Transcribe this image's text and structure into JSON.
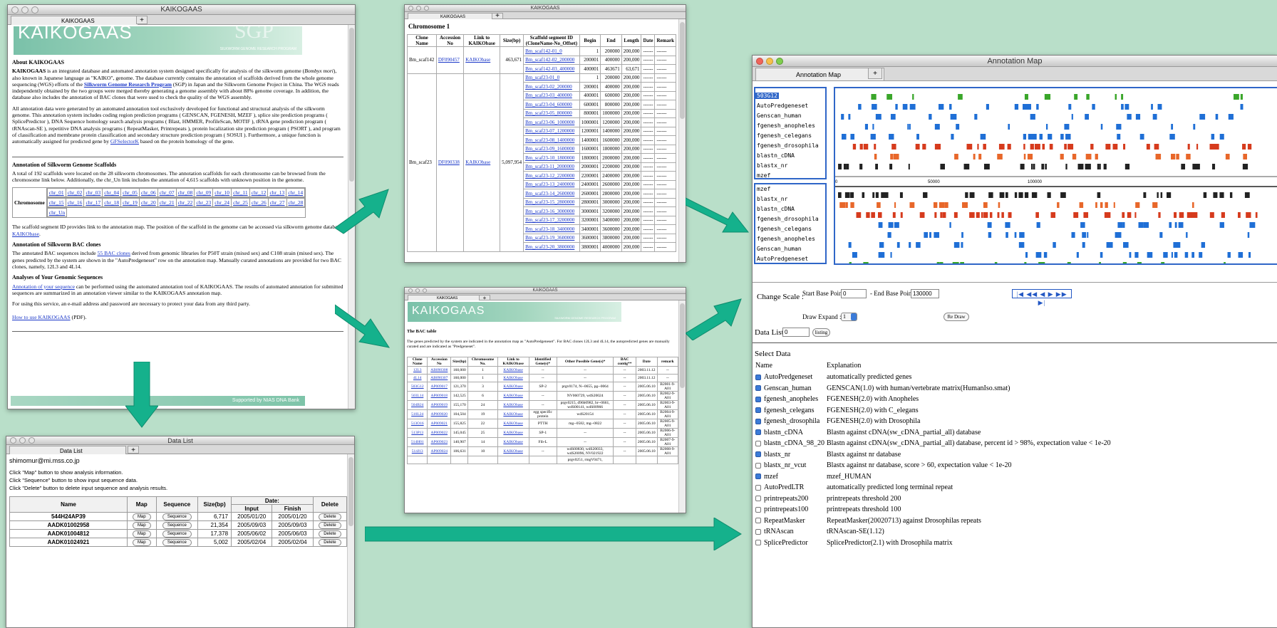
{
  "main_window": {
    "title": "KAIKOGAAS",
    "tab": "KAIKOGAAS",
    "banner": "KAIKOGAAS",
    "banner_sub": "SILKWORM GENOME RESEARCH PROGRAM",
    "banner_logo": "SGP",
    "about_heading": "About KAIKOGAAS",
    "about_p1_a": "KAIKOGAAS",
    "about_p1_b": " is an integrated database and automated annotation system designed specifically for analysis of the silkworm genome (",
    "about_p1_c": "Bombyx mori",
    "about_p1_d": "), also known in Japanese language as \"KAIKO\", genome. The database currently contains the annotation of scaffolds derived from the whole genome sequencing (WGS) efforts of the ",
    "about_p1_link": "Silkworm Genome Research Program",
    "about_p1_e": " (SGP) in Japan and the Silkworm Genome Project in China. The WGS reads independently obtained by the two groups were merged thereby generating a genome assembly with about 88% genome coverage. In addition, the database also includes the annotation of BAC clones that were used to check the quality of the WGS assembly.",
    "about_p2_a": "All annotation data were generated by an automated annotation tool exclusively developed for functional and structural analysis of the silkworm genome. This annotation system includes coding region prediction programs ( GENSCAN, FGENESH, MZEF ), splice site prediction programs ( SplicePredictor ), DNA Sequence homology search analysis programs ( Blast, HMMER, ProfileScan, MOTIF ), tRNA gene prediction program ( tRNAscan-SE ), repetitive DNA analysis programs ( RepeatMasker, Printrepeats ), protein localization site prediction program ( PSORT ), and program of classification and membrane protein classification and secondary structure prediction program ( SOSUI ). Furthermore, a unique function is automatically assigned for predicted gene by ",
    "about_p2_link": "GFSelectorK",
    "about_p2_b": " based on the protein homology of the gene.",
    "scaffold_heading": "Annotation of Silkworm Genome Scaffolds",
    "scaffold_p": "A total of 192 scaffolds were located on the 28 silkworm chromosomes. The annotation scaffolds for each chromosome can be browsed from the chromosome link below. Additionally, the chr_Un link includes the anntation of 4,615 scaffolds with unknown position in the genome.",
    "chromosome_label": "Chromosome",
    "chr_row1": [
      "chr_01",
      "chr_02",
      "chr_03",
      "chr_04",
      "chr_05",
      "chr_06",
      "chr_07",
      "chr_08",
      "chr_09",
      "chr_10",
      "chr_11",
      "chr_12",
      "chr_13",
      "chr_14"
    ],
    "chr_row2": [
      "chr_15",
      "chr_16",
      "chr_17",
      "chr_18",
      "chr_19",
      "chr_20",
      "chr_21",
      "chr_22",
      "chr_23",
      "chr_24",
      "chr_25",
      "chr_26",
      "chr_27",
      "chr_28"
    ],
    "chr_row3": [
      "chr_Un"
    ],
    "segment_p_a": "The scaffold segment ID provides link to the annotation map. The position of the scaffold in the genome can be accessed via silkworm genome database, ",
    "segment_p_link": "KAIKObase",
    "segment_p_b": ".",
    "bac_heading": "Annotation of Silkworm BAC clones",
    "bac_p_a": "The annotated BAC sequences include ",
    "bac_p_link": "55 BAC clones",
    "bac_p_b": " derived from genomic libraries for P50T strain (mixed sex) and C108 strain (mixed sex). The genes predicted by the system are shown in the \"AutoPredgeneset\" row on the annotation map. Manually curated annotations are provided for two BAC clones, namely, 12L3 and 4L14.",
    "analyses_heading": "Analyses of Your Genomic Sequences",
    "analyses_link": "Annotation of your sequence",
    "analyses_p": " can be performed using the automated annotation tool of KAIKOGAAS. The results of automated annotation for submitted sequences are summarized in an annotation viewer similar to the KAIKOGAAS annotation map.",
    "service_p": "For using this service, an e-mail address and password are necessary to protect your data from any third party.",
    "howto_link": "How to use KAIKOGAAS",
    "howto_suffix": " (PDF).",
    "footer": "Supported by NIAS DNA Bank"
  },
  "chromosome_window": {
    "title": "KAIKOGAAS",
    "tab": "KAIKOGAAS",
    "heading": "Chromosome 1",
    "headers": [
      "Clone Name",
      "Accession No",
      "Link to KAIKObase",
      "Size(bp)",
      "Scaffold segment ID (CloneName-No_Offset)",
      "Begin",
      "End",
      "Length",
      "Date",
      "Remark"
    ],
    "group1": {
      "clone": "Bm_scaf142",
      "accession": "DF090457",
      "link": "KAIKObase",
      "size": "463,671"
    },
    "group2": {
      "clone": "Bm_scaf23",
      "accession": "DF090338",
      "link": "KAIKObase",
      "size": "5,097,954"
    },
    "rows": [
      [
        "Bm_scaf142-01_0",
        "1",
        "200000",
        "200,000",
        "------",
        "------"
      ],
      [
        "Bm_scaf142-02_200000",
        "200001",
        "400000",
        "200,000",
        "------",
        "------"
      ],
      [
        "Bm_scaf142-03_400000",
        "400001",
        "463671",
        "63,671",
        "------",
        "------"
      ],
      [
        "Bm_scaf23-01_0",
        "1",
        "200000",
        "200,000",
        "------",
        "------"
      ],
      [
        "Bm_scaf23-02_200000",
        "200001",
        "400000",
        "200,000",
        "------",
        "------"
      ],
      [
        "Bm_scaf23-03_400000",
        "400001",
        "600000",
        "200,000",
        "------",
        "------"
      ],
      [
        "Bm_scaf23-04_600000",
        "600001",
        "800000",
        "200,000",
        "------",
        "------"
      ],
      [
        "Bm_scaf23-05_800000",
        "800001",
        "1000000",
        "200,000",
        "------",
        "------"
      ],
      [
        "Bm_scaf23-06_1000000",
        "1000001",
        "1200000",
        "200,000",
        "------",
        "------"
      ],
      [
        "Bm_scaf23-07_1200000",
        "1200001",
        "1400000",
        "200,000",
        "------",
        "------"
      ],
      [
        "Bm_scaf23-08_1400000",
        "1400001",
        "1600000",
        "200,000",
        "------",
        "------"
      ],
      [
        "Bm_scaf23-09_1600000",
        "1600001",
        "1800000",
        "200,000",
        "------",
        "------"
      ],
      [
        "Bm_scaf23-10_1800000",
        "1800001",
        "2000000",
        "200,000",
        "------",
        "------"
      ],
      [
        "Bm_scaf23-11_2000000",
        "2000001",
        "2200000",
        "200,000",
        "------",
        "------"
      ],
      [
        "Bm_scaf23-12_2200000",
        "2200001",
        "2400000",
        "200,000",
        "------",
        "------"
      ],
      [
        "Bm_scaf23-13_2400000",
        "2400001",
        "2600000",
        "200,000",
        "------",
        "------"
      ],
      [
        "Bm_scaf23-14_2600000",
        "2600001",
        "2800000",
        "200,000",
        "------",
        "------"
      ],
      [
        "Bm_scaf23-15_2800000",
        "2800001",
        "3000000",
        "200,000",
        "------",
        "------"
      ],
      [
        "Bm_scaf23-16_3000000",
        "3000001",
        "3200000",
        "200,000",
        "------",
        "------"
      ],
      [
        "Bm_scaf23-17_3200000",
        "3200001",
        "3400000",
        "200,000",
        "------",
        "------"
      ],
      [
        "Bm_scaf23-18_3400000",
        "3400001",
        "3600000",
        "200,000",
        "------",
        "------"
      ],
      [
        "Bm_scaf23-19_3600000",
        "3600001",
        "3800000",
        "200,000",
        "------",
        "------"
      ],
      [
        "Bm_scaf23-20_3800000",
        "3800001",
        "4000000",
        "200,000",
        "------",
        "------"
      ]
    ]
  },
  "bac_window": {
    "title": "KAIKOGAAS",
    "tab": "KAIKOGAAS",
    "banner": "KAIKOGAAS",
    "banner_sub": "SILKWORM GENOME RESEARCH PROGRAM",
    "heading": "The BAC table",
    "intro": "The genes predicted by the system are indicated in the annotation map as \"AutoPredgeneset\". For BAC clones 12L3 and 4L14, the autopredicted genes are manually curated and are indicated as \"Predgeneset\".",
    "headers": [
      "Clone Name",
      "Accession No",
      "Size(bp)",
      "Chromosome No.",
      "Link to KAIKObase",
      "Identified Gene(s)*",
      "Other Possible Gene(s)*",
      "BAC contig**",
      "Date",
      "remark"
    ],
    "rows": [
      [
        "12L3",
        "AB090308",
        "160,000",
        "1",
        "KAIKObase",
        "--",
        "--",
        "--",
        "2003.11.12",
        "--"
      ],
      [
        "4L14",
        "AB090307",
        "160,000",
        "1",
        "KAIKObase",
        "--",
        "--",
        "--",
        "2003.11.12",
        "--"
      ],
      [
        "503G12",
        "AP009017",
        "121,370",
        "3",
        "KAIKObase",
        "SP-2",
        "prgv0174, N--0655, pg--0064",
        "--",
        "2005.06.10",
        "B2001-9-A01"
      ],
      [
        "503L14",
        "AP009018",
        "142,525",
        "6",
        "KAIKObase",
        "--",
        "NV060729, wdS20024",
        "--",
        "2005.06.10",
        "B2002-9-A01"
      ],
      [
        "504B24",
        "AP009019",
        "155,170",
        "24",
        "KAIKObase",
        "--",
        "prgv0215, d96b0982, br--0661, wdS00141, wdS00966",
        "--",
        "2005.06.10",
        "B2003-9-A01"
      ],
      [
        "510L24",
        "AP009020",
        "104,504",
        "19",
        "KAIKObase",
        "egg specific protein",
        "wdS20154",
        "--",
        "2005.06.10",
        "B2004-9-A01"
      ],
      [
        "513O16",
        "AP009021",
        "155,825",
        "22",
        "KAIKObase",
        "PTTH",
        "mg--0582, mg--0822",
        "--",
        "2005.06.10",
        "B2005-9-A01"
      ],
      [
        "513P13",
        "AP009022",
        "145,045",
        "25",
        "KAIKObase",
        "SP-1",
        "--",
        "--",
        "2005.06.10",
        "B2006-9-A01"
      ],
      [
        "514H01",
        "AP009023",
        "140,907",
        "14",
        "KAIKObase",
        "Fib-L",
        "--",
        "--",
        "2005.06.10",
        "B2007-9-A01"
      ],
      [
        "514J13",
        "AP009024",
        "106,631",
        "10",
        "KAIKObase",
        "--",
        "wdS00830, wdS20033, wdS20096, NV021922",
        "--",
        "2005.06.10",
        "B2008-9-A01"
      ],
      [
        "",
        "",
        "",
        "",
        "",
        "",
        "prgv0251, rmgV0471,",
        "",
        "",
        ""
      ]
    ]
  },
  "datalist_window": {
    "title": "Data List",
    "tab": "Data List",
    "email": "shimomur@mi.mss.co.jp",
    "help1": "Click \"Map\" button to show analysis information.",
    "help2": "Click \"Sequence\" button to show input sequence data.",
    "help3": "Click \"Delete\" button to delete input sequence and analysis results.",
    "headers": {
      "name": "Name",
      "map": "Map",
      "sequence": "Sequence",
      "size": "Size(bp)",
      "date": "Date:",
      "input": "Input",
      "finish": "Finish",
      "delete": "Delete"
    },
    "button_map": "Map",
    "button_sequence": "Sequence",
    "button_delete": "Delete",
    "rows": [
      [
        "544H24AP39",
        "6,717",
        "2005/01/20",
        "2005/01/20"
      ],
      [
        "AADK01002958",
        "21,354",
        "2005/09/03",
        "2005/09/03"
      ],
      [
        "AADK01004812",
        "17,378",
        "2005/06/02",
        "2005/06/03"
      ],
      [
        "AADK01024921",
        "5,002",
        "2005/02/04",
        "2005/02/04"
      ]
    ]
  },
  "annotation_window": {
    "title": "Annotation Map",
    "tab": "Annotation Map",
    "clone_id": "503G12",
    "tracks_top": [
      "AutoPredgeneset",
      "Genscan_human",
      "fgenesh_anopheles",
      "fgenesh_celegans",
      "fgenesh_drosophila",
      "blastn_cDNA",
      "blastx_nr",
      "mzef"
    ],
    "tracks_bottom": [
      "mzef",
      "blastx_nr",
      "blastn_cDNA",
      "fgenesh_drosophila",
      "fgenesh_celegans",
      "fgenesh_anopheles",
      "Genscan_human",
      "AutoPredgeneset"
    ],
    "axis_ticks": [
      "0",
      "50000",
      "100000"
    ],
    "change_scale": "Change Scale :",
    "start_label": "Start Base Point",
    "start_value": "0",
    "end_label": "- End Base Point",
    "end_value": "130000",
    "draw_expand_label": "Draw Expand :",
    "draw_expand_value": "1",
    "redraw": "Re Draw",
    "data_list_label": "Data List:",
    "data_list_value": "0",
    "listing": "listing",
    "select_data": "Select Data",
    "col_name": "Name",
    "col_expl": "Explanation",
    "nav_glyphs": "|◀ ◀◀ ◀  ▶ ▶▶ ▶|",
    "items": [
      {
        "name": "AutoPredgeneset",
        "checked": true,
        "expl": "automatically predicted genes"
      },
      {
        "name": "Genscan_human",
        "checked": true,
        "expl": "GENSCAN(1.0) with human/vertebrate matrix(HumanIso.smat)"
      },
      {
        "name": "fgenesh_anopheles",
        "checked": true,
        "expl": "FGENESH(2.0) with Anopheles"
      },
      {
        "name": "fgenesh_celegans",
        "checked": true,
        "expl": "FGENESH(2.0) with C_elegans"
      },
      {
        "name": "fgenesh_drosophila",
        "checked": true,
        "expl": "FGENESH(2.0) with Drosophila"
      },
      {
        "name": "blastn_cDNA",
        "checked": true,
        "expl": "Blastn against cDNA(sw_cDNA_partial_all) database"
      },
      {
        "name": "blastn_cDNA_98_20",
        "checked": false,
        "expl": "Blastn against cDNA(sw_cDNA_partial_all) database, percent id > 98%, expectation value < 1e-20"
      },
      {
        "name": "blastx_nr",
        "checked": true,
        "expl": "Blastx against nr database"
      },
      {
        "name": "blastx_nr_vcut",
        "checked": false,
        "expl": "Blastx against nr database, score > 60, expectation value < 1e-20"
      },
      {
        "name": "mzef",
        "checked": true,
        "expl": "mzef_HUMAN"
      },
      {
        "name": "AutoPredLTR",
        "checked": false,
        "expl": "automatically predicted long terminal repeat"
      },
      {
        "name": "printrepeats200",
        "checked": false,
        "expl": "printrepeats threshold 200"
      },
      {
        "name": "printrepeats100",
        "checked": false,
        "expl": "printrepeats threshold 100"
      },
      {
        "name": "RepeatMasker",
        "checked": false,
        "expl": "RepeatMasker(20020713) against Drosophilas repeats"
      },
      {
        "name": "tRNAscan",
        "checked": false,
        "expl": "tRNAscan-SE(1.12)"
      },
      {
        "name": "SplicePredictor",
        "checked": false,
        "expl": "SplicePredictor(2.1) with Drosophila matrix"
      }
    ]
  },
  "colors": {
    "arrow": "#13b38d",
    "green": "#3aa62a",
    "blue": "#1f6fd6",
    "red": "#d63b1d",
    "orange": "#e8672a",
    "black": "#222222"
  }
}
